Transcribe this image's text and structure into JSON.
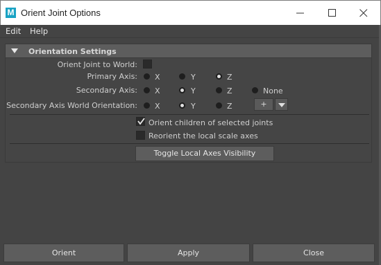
{
  "window": {
    "app_icon_letter": "M",
    "title": "Orient Joint Options",
    "controls": [
      "minimize-icon",
      "maximize-icon",
      "close-icon"
    ]
  },
  "menu": {
    "items": [
      "Edit",
      "Help"
    ]
  },
  "frame": {
    "title": "Orientation Settings",
    "orient_to_world": {
      "label": "Orient Joint to World:",
      "checked": false
    },
    "primary_axis": {
      "label": "Primary Axis:",
      "options": [
        "X",
        "Y",
        "Z"
      ],
      "selected": "Z"
    },
    "secondary_axis": {
      "label": "Secondary Axis:",
      "options": [
        "X",
        "Y",
        "Z",
        "None"
      ],
      "selected": "Y"
    },
    "secondary_world": {
      "label": "Secondary Axis World Orientation:",
      "options": [
        "X",
        "Y",
        "Z"
      ],
      "selected": "Y",
      "sign": "+"
    },
    "orient_children": {
      "label": "Orient children of selected joints",
      "checked": true
    },
    "reorient_scale": {
      "label": "Reorient the local scale axes",
      "checked": false
    },
    "toggle_button": "Toggle Local Axes Visibility"
  },
  "buttons": {
    "orient": "Orient",
    "apply": "Apply",
    "close": "Close"
  }
}
